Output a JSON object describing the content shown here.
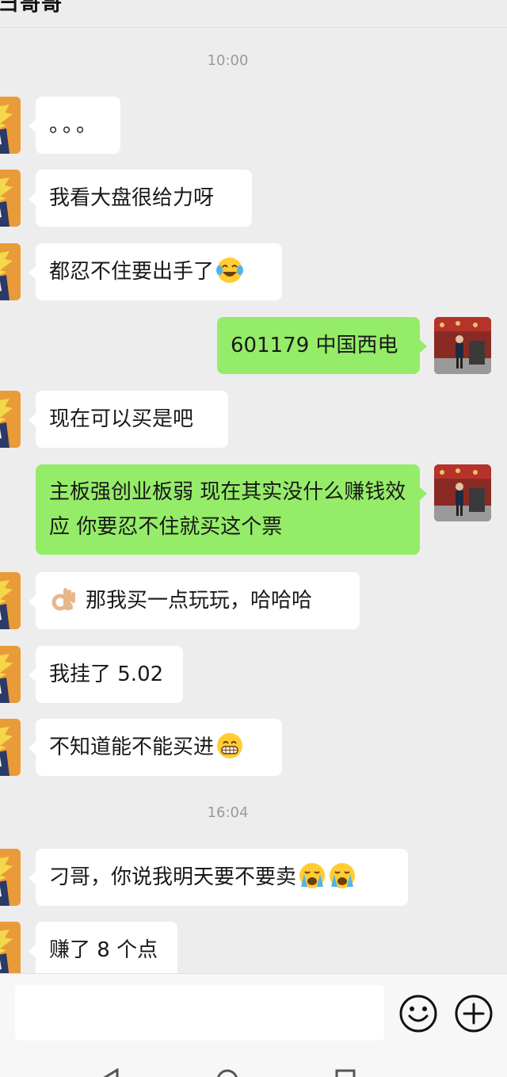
{
  "header": {
    "title": "彐哥哥"
  },
  "messages": {
    "time1": "10:00",
    "m1": "。。。",
    "m2": "我看大盘很给力呀",
    "m3": "都忍不住要出手了",
    "m4": "601179 中国西电",
    "m5": "现在可以买是吧",
    "m6": "主板强创业板弱 现在其实没什么赚钱效应 你要忍不住就买这个票",
    "m7": "那我买一点玩玩，哈哈哈",
    "m8": "我挂了 5.02",
    "m9": "不知道能不能买进",
    "time2": "16:04",
    "m10": "刁哥，你说我明天要不要卖",
    "m11": "赚了 8 个点"
  },
  "icons": {
    "emoji_laugh": "face-with-tears-of-joy-icon",
    "emoji_ok": "ok-hand-icon",
    "emoji_grin": "grinning-face-icon",
    "emoji_cry": "loudly-crying-face-icon",
    "emoji_button": "emoji-button-icon",
    "plus_button": "plus-button-icon"
  },
  "colors": {
    "incoming_bubble": "#ffffff",
    "outgoing_bubble": "#95ec69",
    "background": "#ededed"
  }
}
